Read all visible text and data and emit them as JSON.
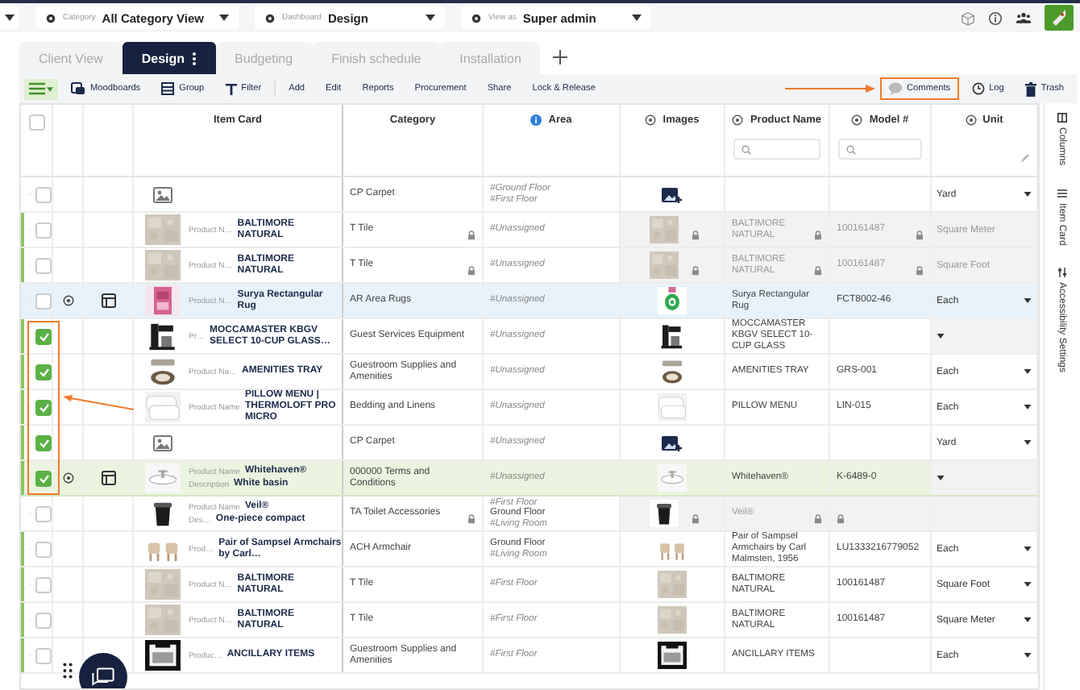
{
  "header": {
    "filters": [
      {
        "label": "Category",
        "value": "All Category View"
      },
      {
        "label": "Dashboard",
        "value": "Design"
      },
      {
        "label": "View as",
        "value": "Super admin"
      }
    ]
  },
  "tabs": [
    {
      "label": "Client View",
      "selected": false
    },
    {
      "label": "Design",
      "selected": true
    },
    {
      "label": "Budgeting",
      "selected": false
    },
    {
      "label": "Finish schedule",
      "selected": false
    },
    {
      "label": "Installation",
      "selected": false
    }
  ],
  "toolbar": {
    "left": [
      {
        "label": "Moodboards",
        "kind": "moodboards"
      },
      {
        "label": "Group",
        "kind": "group"
      },
      {
        "label": "Filter",
        "kind": "filter"
      },
      {
        "label": "Add",
        "kind": "text"
      },
      {
        "label": "Edit",
        "kind": "text"
      },
      {
        "label": "Reports",
        "kind": "text"
      },
      {
        "label": "Procurement",
        "kind": "text"
      },
      {
        "label": "Share",
        "kind": "text"
      },
      {
        "label": "Lock & Release",
        "kind": "text"
      }
    ],
    "right": [
      {
        "label": "Comments",
        "kind": "comment",
        "highlighted": true
      },
      {
        "label": "Log",
        "kind": "log",
        "highlighted": false
      },
      {
        "label": "Trash",
        "kind": "trash",
        "highlighted": false
      }
    ]
  },
  "table": {
    "all_checked": false,
    "columns": [
      {
        "label": "Item Card",
        "kind": "plain",
        "search": false,
        "editable": false
      },
      {
        "label": "Category",
        "kind": "plain",
        "search": false,
        "editable": false
      },
      {
        "label": "Area",
        "kind": "info",
        "search": false,
        "editable": false
      },
      {
        "label": "Images",
        "kind": "eye",
        "search": false,
        "editable": false
      },
      {
        "label": "Product Name",
        "kind": "eye",
        "search": true,
        "editable": false
      },
      {
        "label": "Model #",
        "kind": "eye",
        "search": true,
        "editable": false
      },
      {
        "label": "Unit",
        "kind": "eye",
        "search": false,
        "editable": true
      }
    ],
    "rows": [
      {
        "checked": false,
        "marked": false,
        "selected": false,
        "highlighted": false,
        "grouped": false,
        "locked": false,
        "thumb": {
          "kind": "placeholder"
        },
        "card": [],
        "category": "CP Carpet",
        "area": [
          {
            "text": "#Ground Floor",
            "tag": true
          },
          {
            "text": "#First Floor",
            "tag": true
          }
        ],
        "image": {
          "kind": "add"
        },
        "product": "",
        "model": "",
        "unit": "Yard"
      },
      {
        "checked": false,
        "marked": true,
        "selected": false,
        "highlighted": false,
        "grouped": false,
        "locked": true,
        "thumb": {
          "kind": "picture"
        },
        "card": [
          {
            "label": "Product N…",
            "value": "BALTIMORE NATURAL"
          }
        ],
        "category": "T Tile",
        "area": [
          {
            "text": "#Unassigned",
            "tag": true
          }
        ],
        "image": {
          "kind": "picture"
        },
        "product": "BALTIMORE NATURAL",
        "model": "100161487",
        "unit": "Square Meter"
      },
      {
        "checked": false,
        "marked": true,
        "selected": false,
        "highlighted": false,
        "grouped": false,
        "locked": true,
        "thumb": {
          "kind": "picture"
        },
        "card": [
          {
            "label": "Product N…",
            "value": "BALTIMORE NATURAL"
          }
        ],
        "category": "T Tile",
        "area": [
          {
            "text": "#Unassigned",
            "tag": true
          }
        ],
        "image": {
          "kind": "picture"
        },
        "product": "BALTIMORE NATURAL",
        "model": "100161487",
        "unit": "Square Foot"
      },
      {
        "checked": false,
        "marked": false,
        "selected": true,
        "highlighted": false,
        "grouped": true,
        "locked": false,
        "thumb": {
          "kind": "picture"
        },
        "card": [
          {
            "label": "Product N…",
            "value": "Surya Rectangular Rug"
          }
        ],
        "category": "AR Area Rugs",
        "area": [
          {
            "text": "#Unassigned",
            "tag": true
          }
        ],
        "image": {
          "kind": "picture"
        },
        "product": "Surya Rectangular Rug",
        "model": "FCT8002-46",
        "unit": "Each"
      },
      {
        "checked": true,
        "marked": true,
        "selected": false,
        "highlighted": false,
        "grouped": false,
        "locked": false,
        "thumb": {
          "kind": "picture"
        },
        "card": [
          {
            "label": "Pr…",
            "value": "MOCCAMASTER KBGV SELECT 10-CUP GLASS…"
          }
        ],
        "category": "Guest Services Equipment",
        "area": [
          {
            "text": "#Unassigned",
            "tag": true
          }
        ],
        "image": {
          "kind": "picture"
        },
        "product": "MOCCAMASTER KBGV SELECT 10-CUP GLASS",
        "model": "",
        "unit": ""
      },
      {
        "checked": true,
        "marked": true,
        "selected": false,
        "highlighted": false,
        "grouped": false,
        "locked": false,
        "thumb": {
          "kind": "picture"
        },
        "card": [
          {
            "label": "Product Na…",
            "value": "AMENITIES TRAY"
          }
        ],
        "category": "Guestroom Supplies and Amenities",
        "area": [
          {
            "text": "#Unassigned",
            "tag": true
          }
        ],
        "image": {
          "kind": "picture"
        },
        "product": "AMENITIES TRAY",
        "model": "GRS-001",
        "unit": "Each"
      },
      {
        "checked": true,
        "marked": true,
        "selected": false,
        "highlighted": false,
        "grouped": false,
        "locked": false,
        "thumb": {
          "kind": "picture"
        },
        "card": [
          {
            "label": "Product Name",
            "value": "PILLOW MENU | THERMOLOFT PRO MICRO"
          }
        ],
        "category": "Bedding and Linens",
        "area": [
          {
            "text": "#Unassigned",
            "tag": true
          }
        ],
        "image": {
          "kind": "picture"
        },
        "product": "PILLOW MENU",
        "model": "LIN-015",
        "unit": "Each"
      },
      {
        "checked": true,
        "marked": true,
        "selected": false,
        "highlighted": false,
        "grouped": false,
        "locked": false,
        "thumb": {
          "kind": "placeholder"
        },
        "card": [],
        "category": "CP Carpet",
        "area": [
          {
            "text": "#Unassigned",
            "tag": true
          }
        ],
        "image": {
          "kind": "add"
        },
        "product": "",
        "model": "",
        "unit": "Yard"
      },
      {
        "checked": true,
        "marked": true,
        "selected": false,
        "highlighted": true,
        "grouped": true,
        "locked": false,
        "thumb": {
          "kind": "picture"
        },
        "card": [
          {
            "label": "Product Name",
            "value": "Whitehaven®"
          },
          {
            "label": "Description",
            "value": "White basin"
          }
        ],
        "category": "000000 Terms and Conditions",
        "area": [
          {
            "text": "#Unassigned",
            "tag": true
          }
        ],
        "image": {
          "kind": "picture"
        },
        "product": "Whitehaven®",
        "model": "K-6489-0",
        "unit": ""
      },
      {
        "checked": false,
        "marked": false,
        "selected": false,
        "highlighted": false,
        "grouped": false,
        "locked": true,
        "thumb": {
          "kind": "picture"
        },
        "card": [
          {
            "label": "Product Name",
            "value": "Veil®"
          },
          {
            "label": "Des…",
            "value": "One-piece compact"
          }
        ],
        "category": "TA Toilet Accessories",
        "area": [
          {
            "text": "#First Floor",
            "tag": true
          },
          {
            "text": "Ground Floor",
            "tag": false
          },
          {
            "text": "#Living Room",
            "tag": true
          }
        ],
        "image": {
          "kind": "picture"
        },
        "product": "Veil®",
        "model": "",
        "unit": ""
      },
      {
        "checked": false,
        "marked": true,
        "selected": false,
        "highlighted": false,
        "grouped": false,
        "locked": false,
        "thumb": {
          "kind": "picture"
        },
        "card": [
          {
            "label": "Prod…",
            "value": "Pair of Sampsel Armchairs by Carl…"
          }
        ],
        "category": "ACH Armchair",
        "area": [
          {
            "text": "Ground Floor",
            "tag": false
          },
          {
            "text": "#Living Room",
            "tag": true
          }
        ],
        "image": {
          "kind": "picture"
        },
        "product": "Pair of Sampsel Armchairs by Carl Malmsten, 1956",
        "model": "LU1333216779052",
        "unit": "Each"
      },
      {
        "checked": false,
        "marked": true,
        "selected": false,
        "highlighted": false,
        "grouped": false,
        "locked": false,
        "thumb": {
          "kind": "picture"
        },
        "card": [
          {
            "label": "Product N…",
            "value": "BALTIMORE NATURAL"
          }
        ],
        "category": "T Tile",
        "area": [
          {
            "text": "#First Floor",
            "tag": true
          }
        ],
        "image": {
          "kind": "picture"
        },
        "product": "BALTIMORE NATURAL",
        "model": "100161487",
        "unit": "Square Foot"
      },
      {
        "checked": false,
        "marked": true,
        "selected": false,
        "highlighted": false,
        "grouped": false,
        "locked": false,
        "thumb": {
          "kind": "picture"
        },
        "card": [
          {
            "label": "Product N…",
            "value": "BALTIMORE NATURAL"
          }
        ],
        "category": "T Tile",
        "area": [
          {
            "text": "#First Floor",
            "tag": true
          }
        ],
        "image": {
          "kind": "picture"
        },
        "product": "BALTIMORE NATURAL",
        "model": "100161487",
        "unit": "Square Meter"
      },
      {
        "checked": false,
        "marked": true,
        "selected": false,
        "highlighted": false,
        "grouped": false,
        "locked": false,
        "thumb": {
          "kind": "picture"
        },
        "card": [
          {
            "label": "Produc…",
            "value": "ANCILLARY ITEMS"
          }
        ],
        "category": "Guestroom Supplies and Amenities",
        "area": [
          {
            "text": "#First Floor",
            "tag": true
          }
        ],
        "image": {
          "kind": "picture"
        },
        "product": "ANCILLARY ITEMS",
        "model": "",
        "unit": "Each"
      }
    ]
  },
  "side_panel": [
    "Columns",
    "Item Card",
    "Accessibility Settings"
  ],
  "checkbox_callout": true
}
